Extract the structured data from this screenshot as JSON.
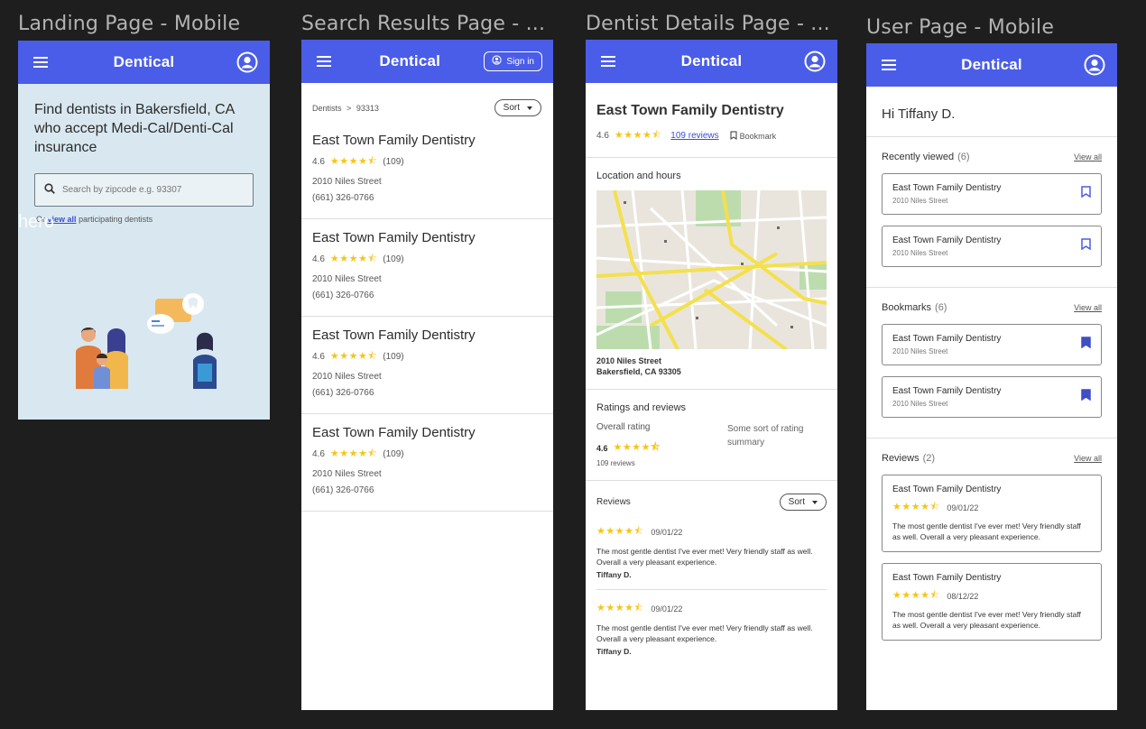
{
  "frames": {
    "landing": "Landing Page - Mobile",
    "search": "Search Results Page - ...",
    "details": "Dentist Details Page - ...",
    "user": "User Page - Mobile"
  },
  "app": {
    "name": "Dentical",
    "signin": "Sign in"
  },
  "icons": {
    "menu": "menu-icon",
    "account": "account-circle-icon",
    "search": "search-icon",
    "bookmark": "bookmark-icon"
  },
  "colors": {
    "primary": "#4a5de8",
    "star": "#f5c518",
    "landing_bg": "#d9e8f0"
  },
  "landing": {
    "headline": "Find dentists in Bakersfield, CA who accept Medi-Cal/Denti-Cal insurance",
    "search_placeholder": "Search by zipcode e.g. 93307",
    "or_text": "Or",
    "view_all": "view all",
    "participating": "participating dentists",
    "hero_label": "hero"
  },
  "search": {
    "breadcrumb_root": "Dentists",
    "breadcrumb_sep": ">",
    "breadcrumb_zip": "93313",
    "sort": "Sort",
    "results": [
      {
        "name": "East Town Family Dentistry",
        "rating": "4.6",
        "stars": "★★★★⯪",
        "count": "(109)",
        "street": "2010 Niles Street",
        "phone": "(661) 326-0766"
      },
      {
        "name": "East Town Family Dentistry",
        "rating": "4.6",
        "stars": "★★★★⯪",
        "count": "(109)",
        "street": "2010 Niles Street",
        "phone": "(661) 326-0766"
      },
      {
        "name": "East Town Family Dentistry",
        "rating": "4.6",
        "stars": "★★★★⯪",
        "count": "(109)",
        "street": "2010 Niles Street",
        "phone": "(661) 326-0766"
      },
      {
        "name": "East Town Family Dentistry",
        "rating": "4.6",
        "stars": "★★★★⯪",
        "count": "(109)",
        "street": "2010 Niles Street",
        "phone": "(661) 326-0766"
      }
    ]
  },
  "details": {
    "name": "East Town Family Dentistry",
    "rating": "4.6",
    "stars": "★★★★⯪",
    "reviews_link": "109 reviews",
    "bookmark": "Bookmark",
    "location_title": "Location and hours",
    "address1": "2010 Niles Street",
    "address2": "Bakersfield, CA 93305",
    "ratings_title": "Ratings and reviews",
    "overall_label": "Overall rating",
    "overall_value": "4.6",
    "overall_count": "109 reviews",
    "summary": "Some sort of rating summary",
    "reviews_title": "Reviews",
    "sort": "Sort",
    "reviews": [
      {
        "stars": "★★★★⯪",
        "date": "09/01/22",
        "text": "The most gentle dentist I've ever met! Very friendly staff as well. Overall a very pleasant experience.",
        "author": "Tiffany D."
      },
      {
        "stars": "★★★★⯪",
        "date": "09/01/22",
        "text": "The most gentle dentist I've ever met! Very friendly staff as well. Overall a very pleasant experience.",
        "author": "Tiffany D."
      }
    ]
  },
  "user": {
    "greeting": "Hi Tiffany D.",
    "view_all": "View all",
    "recent_title": "Recently viewed",
    "recent_count": "(6)",
    "recent": [
      {
        "name": "East Town Family Dentistry",
        "street": "2010 Niles Street"
      },
      {
        "name": "East Town Family Dentistry",
        "street": "2010 Niles Street"
      }
    ],
    "bookmarks_title": "Bookmarks",
    "bookmarks_count": "(6)",
    "bookmarks": [
      {
        "name": "East Town Family Dentistry",
        "street": "2010 Niles Street"
      },
      {
        "name": "East Town Family Dentistry",
        "street": "2010 Niles Street"
      }
    ],
    "reviews_title": "Reviews",
    "reviews_count": "(2)",
    "reviews": [
      {
        "name": "East Town Family Dentistry",
        "stars": "★★★★⯪",
        "date": "09/01/22",
        "text": "The most gentle dentist I've ever met! Very friendly staff as well. Overall a very pleasant experience."
      },
      {
        "name": "East Town Family Dentistry",
        "stars": "★★★★⯪",
        "date": "08/12/22",
        "text": "The most gentle dentist I've ever met! Very friendly staff as well. Overall a very pleasant experience."
      }
    ]
  }
}
